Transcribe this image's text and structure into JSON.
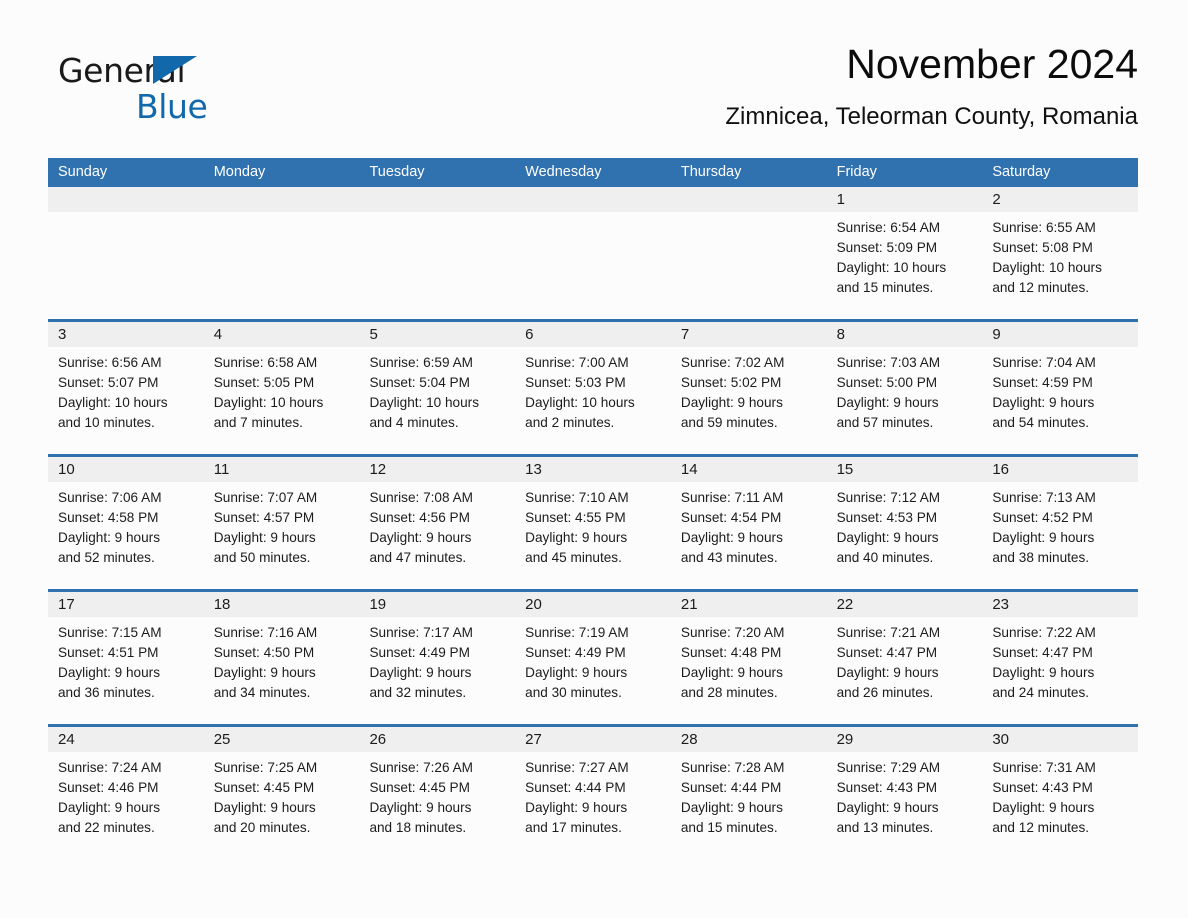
{
  "brand": {
    "name_part1": "General",
    "name_part2": "Blue",
    "logo_icon": "triangle-logo-icon",
    "accent_color": "#1168ab"
  },
  "header": {
    "title": "November 2024",
    "subtitle": "Zimnicea, Teleorman County, Romania"
  },
  "colors": {
    "header_blue": "#3071af",
    "row_rule_blue": "#3071af",
    "number_band_gray": "#efefef",
    "page_background": "#fcfcfd",
    "text": "#1c1c1c"
  },
  "calendar": {
    "weekday_headers": [
      "Sunday",
      "Monday",
      "Tuesday",
      "Wednesday",
      "Thursday",
      "Friday",
      "Saturday"
    ],
    "weeks": [
      {
        "days": [
          {
            "date": "",
            "lines": []
          },
          {
            "date": "",
            "lines": []
          },
          {
            "date": "",
            "lines": []
          },
          {
            "date": "",
            "lines": []
          },
          {
            "date": "",
            "lines": []
          },
          {
            "date": "1",
            "lines": [
              "Sunrise: 6:54 AM",
              "Sunset: 5:09 PM",
              "Daylight: 10 hours",
              "and 15 minutes."
            ]
          },
          {
            "date": "2",
            "lines": [
              "Sunrise: 6:55 AM",
              "Sunset: 5:08 PM",
              "Daylight: 10 hours",
              "and 12 minutes."
            ]
          }
        ]
      },
      {
        "days": [
          {
            "date": "3",
            "lines": [
              "Sunrise: 6:56 AM",
              "Sunset: 5:07 PM",
              "Daylight: 10 hours",
              "and 10 minutes."
            ]
          },
          {
            "date": "4",
            "lines": [
              "Sunrise: 6:58 AM",
              "Sunset: 5:05 PM",
              "Daylight: 10 hours",
              "and 7 minutes."
            ]
          },
          {
            "date": "5",
            "lines": [
              "Sunrise: 6:59 AM",
              "Sunset: 5:04 PM",
              "Daylight: 10 hours",
              "and 4 minutes."
            ]
          },
          {
            "date": "6",
            "lines": [
              "Sunrise: 7:00 AM",
              "Sunset: 5:03 PM",
              "Daylight: 10 hours",
              "and 2 minutes."
            ]
          },
          {
            "date": "7",
            "lines": [
              "Sunrise: 7:02 AM",
              "Sunset: 5:02 PM",
              "Daylight: 9 hours",
              "and 59 minutes."
            ]
          },
          {
            "date": "8",
            "lines": [
              "Sunrise: 7:03 AM",
              "Sunset: 5:00 PM",
              "Daylight: 9 hours",
              "and 57 minutes."
            ]
          },
          {
            "date": "9",
            "lines": [
              "Sunrise: 7:04 AM",
              "Sunset: 4:59 PM",
              "Daylight: 9 hours",
              "and 54 minutes."
            ]
          }
        ]
      },
      {
        "days": [
          {
            "date": "10",
            "lines": [
              "Sunrise: 7:06 AM",
              "Sunset: 4:58 PM",
              "Daylight: 9 hours",
              "and 52 minutes."
            ]
          },
          {
            "date": "11",
            "lines": [
              "Sunrise: 7:07 AM",
              "Sunset: 4:57 PM",
              "Daylight: 9 hours",
              "and 50 minutes."
            ]
          },
          {
            "date": "12",
            "lines": [
              "Sunrise: 7:08 AM",
              "Sunset: 4:56 PM",
              "Daylight: 9 hours",
              "and 47 minutes."
            ]
          },
          {
            "date": "13",
            "lines": [
              "Sunrise: 7:10 AM",
              "Sunset: 4:55 PM",
              "Daylight: 9 hours",
              "and 45 minutes."
            ]
          },
          {
            "date": "14",
            "lines": [
              "Sunrise: 7:11 AM",
              "Sunset: 4:54 PM",
              "Daylight: 9 hours",
              "and 43 minutes."
            ]
          },
          {
            "date": "15",
            "lines": [
              "Sunrise: 7:12 AM",
              "Sunset: 4:53 PM",
              "Daylight: 9 hours",
              "and 40 minutes."
            ]
          },
          {
            "date": "16",
            "lines": [
              "Sunrise: 7:13 AM",
              "Sunset: 4:52 PM",
              "Daylight: 9 hours",
              "and 38 minutes."
            ]
          }
        ]
      },
      {
        "days": [
          {
            "date": "17",
            "lines": [
              "Sunrise: 7:15 AM",
              "Sunset: 4:51 PM",
              "Daylight: 9 hours",
              "and 36 minutes."
            ]
          },
          {
            "date": "18",
            "lines": [
              "Sunrise: 7:16 AM",
              "Sunset: 4:50 PM",
              "Daylight: 9 hours",
              "and 34 minutes."
            ]
          },
          {
            "date": "19",
            "lines": [
              "Sunrise: 7:17 AM",
              "Sunset: 4:49 PM",
              "Daylight: 9 hours",
              "and 32 minutes."
            ]
          },
          {
            "date": "20",
            "lines": [
              "Sunrise: 7:19 AM",
              "Sunset: 4:49 PM",
              "Daylight: 9 hours",
              "and 30 minutes."
            ]
          },
          {
            "date": "21",
            "lines": [
              "Sunrise: 7:20 AM",
              "Sunset: 4:48 PM",
              "Daylight: 9 hours",
              "and 28 minutes."
            ]
          },
          {
            "date": "22",
            "lines": [
              "Sunrise: 7:21 AM",
              "Sunset: 4:47 PM",
              "Daylight: 9 hours",
              "and 26 minutes."
            ]
          },
          {
            "date": "23",
            "lines": [
              "Sunrise: 7:22 AM",
              "Sunset: 4:47 PM",
              "Daylight: 9 hours",
              "and 24 minutes."
            ]
          }
        ]
      },
      {
        "days": [
          {
            "date": "24",
            "lines": [
              "Sunrise: 7:24 AM",
              "Sunset: 4:46 PM",
              "Daylight: 9 hours",
              "and 22 minutes."
            ]
          },
          {
            "date": "25",
            "lines": [
              "Sunrise: 7:25 AM",
              "Sunset: 4:45 PM",
              "Daylight: 9 hours",
              "and 20 minutes."
            ]
          },
          {
            "date": "26",
            "lines": [
              "Sunrise: 7:26 AM",
              "Sunset: 4:45 PM",
              "Daylight: 9 hours",
              "and 18 minutes."
            ]
          },
          {
            "date": "27",
            "lines": [
              "Sunrise: 7:27 AM",
              "Sunset: 4:44 PM",
              "Daylight: 9 hours",
              "and 17 minutes."
            ]
          },
          {
            "date": "28",
            "lines": [
              "Sunrise: 7:28 AM",
              "Sunset: 4:44 PM",
              "Daylight: 9 hours",
              "and 15 minutes."
            ]
          },
          {
            "date": "29",
            "lines": [
              "Sunrise: 7:29 AM",
              "Sunset: 4:43 PM",
              "Daylight: 9 hours",
              "and 13 minutes."
            ]
          },
          {
            "date": "30",
            "lines": [
              "Sunrise: 7:31 AM",
              "Sunset: 4:43 PM",
              "Daylight: 9 hours",
              "and 12 minutes."
            ]
          }
        ]
      }
    ]
  }
}
